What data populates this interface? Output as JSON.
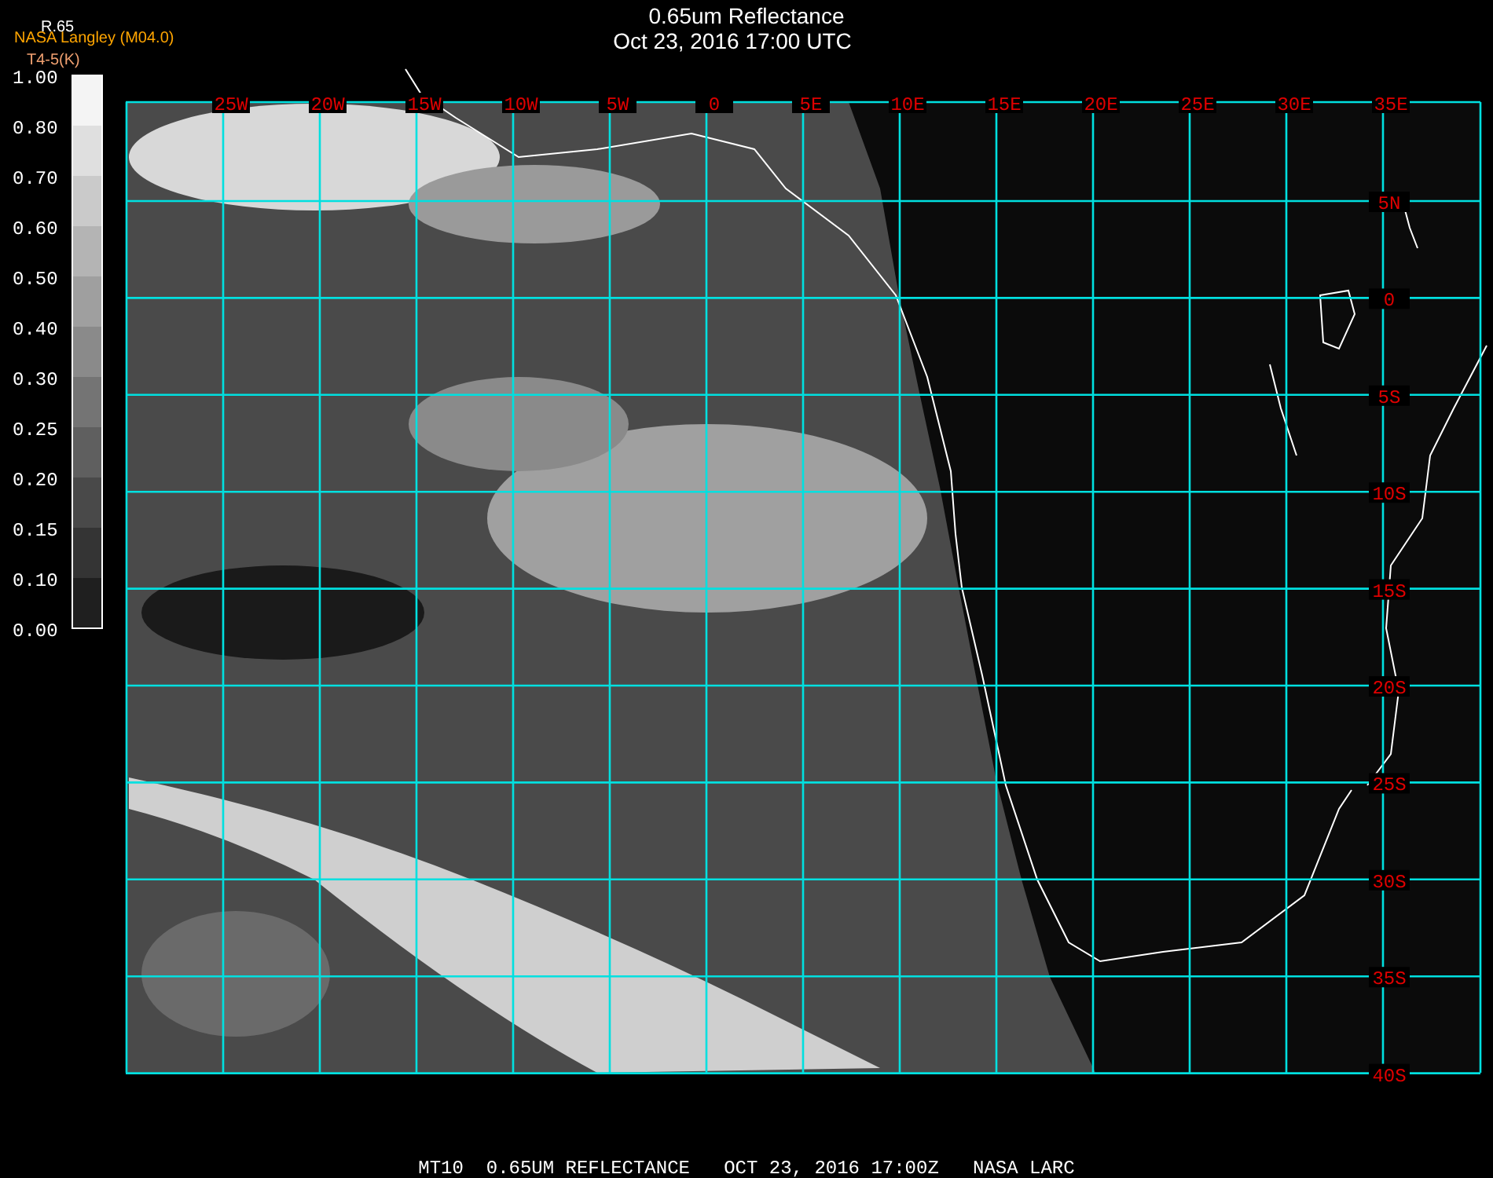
{
  "legend": {
    "variable": "R.65",
    "source": "NASA Langley (M04.0)",
    "units": "T4-5(K)",
    "ticks": [
      "1.00",
      "0.80",
      "0.70",
      "0.60",
      "0.50",
      "0.40",
      "0.30",
      "0.25",
      "0.20",
      "0.15",
      "0.10",
      "0.00"
    ]
  },
  "title": "0.65um Reflectance",
  "subtitle": "Oct 23, 2016 17:00 UTC",
  "longitudes": [
    "25W",
    "20W",
    "15W",
    "10W",
    "5W",
    "0",
    "5E",
    "10E",
    "15E",
    "20E",
    "25E",
    "30E",
    "35E"
  ],
  "latitudes": [
    "5N",
    "0",
    "5S",
    "10S",
    "15S",
    "20S",
    "25S",
    "30S",
    "35S",
    "40S"
  ],
  "status_line": "MT10  0.65UM REFLECTANCE   OCT 23, 2016 17:00Z   NASA LARC"
}
